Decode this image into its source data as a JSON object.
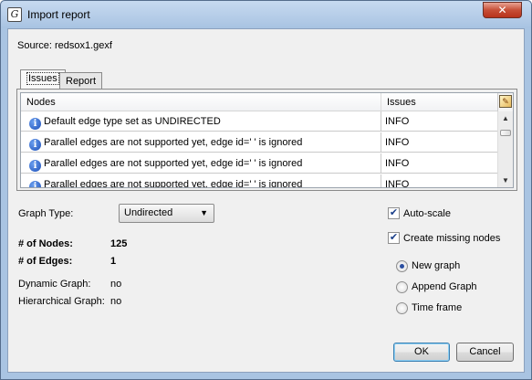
{
  "window": {
    "title": "Import report",
    "app_icon": "Gephi-logo",
    "close_icon": "close-icon"
  },
  "source": {
    "label": "Source:",
    "file": "redsox1.gexf"
  },
  "tabs": [
    {
      "label": "Issues",
      "active": true
    },
    {
      "label": "Report",
      "active": false
    }
  ],
  "issues_table": {
    "columns": [
      "Nodes",
      "Issues"
    ],
    "rows": [
      {
        "message": "Default edge type set as UNDIRECTED",
        "level": "INFO"
      },
      {
        "message": "Parallel edges are not supported yet, edge id=' ' is ignored",
        "level": "INFO"
      },
      {
        "message": "Parallel edges are not supported yet, edge id=' ' is ignored",
        "level": "INFO"
      },
      {
        "message": "Parallel edges are not supported yet, edge id=' ' is ignored",
        "level": "INFO"
      }
    ]
  },
  "graph_type": {
    "label": "Graph Type:",
    "selected": "Undirected"
  },
  "stats": {
    "nodes_label": "# of Nodes:",
    "nodes_value": "125",
    "edges_label": "# of Edges:",
    "edges_value": "1",
    "dynamic_label": "Dynamic Graph:",
    "dynamic_value": "no",
    "hierarchical_label": "Hierarchical Graph:",
    "hierarchical_value": "no"
  },
  "options": {
    "auto_scale": {
      "label": "Auto-scale",
      "checked": true
    },
    "create_missing": {
      "label": "Create missing nodes",
      "checked": true
    }
  },
  "mode": {
    "options": [
      "New graph",
      "Append Graph",
      "Time frame"
    ],
    "selected": "New graph"
  },
  "buttons": {
    "ok": "OK",
    "cancel": "Cancel"
  },
  "colors": {
    "title_bar": "#a9c4e2",
    "close_button": "#c74f37",
    "info_icon": "#1d4fb6"
  }
}
